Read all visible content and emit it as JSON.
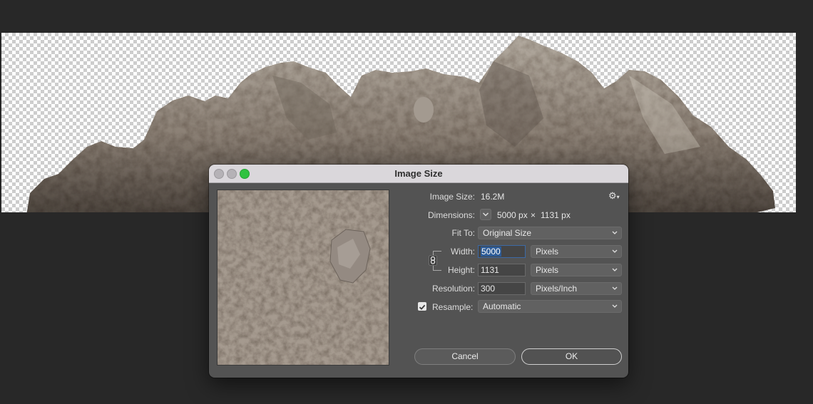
{
  "dialog": {
    "title": "Image Size",
    "image_size_label": "Image Size:",
    "image_size_value": "16.2M",
    "dimensions_label": "Dimensions:",
    "dimensions_width": "5000 px",
    "dimensions_separator": "×",
    "dimensions_height": "1131 px",
    "fit_to_label": "Fit To:",
    "fit_to_value": "Original Size",
    "width_label": "Width:",
    "width_value": "5000",
    "width_unit": "Pixels",
    "height_label": "Height:",
    "height_value": "1131",
    "height_unit": "Pixels",
    "resolution_label": "Resolution:",
    "resolution_value": "300",
    "resolution_unit": "Pixels/Inch",
    "resample_label": "Resample:",
    "resample_checked": true,
    "resample_value": "Automatic",
    "cancel_label": "Cancel",
    "ok_label": "OK"
  },
  "colors": {
    "app_background": "#282828",
    "dialog_background": "#535353",
    "titlebar": "#dad7db",
    "zoom_button": "#2fc240",
    "selection": "#2d5b96"
  },
  "icons": {
    "settings": "gear-icon",
    "chain": "chain-link-icon",
    "chevron": "chevron-down-icon",
    "check": "checkmark-icon"
  }
}
